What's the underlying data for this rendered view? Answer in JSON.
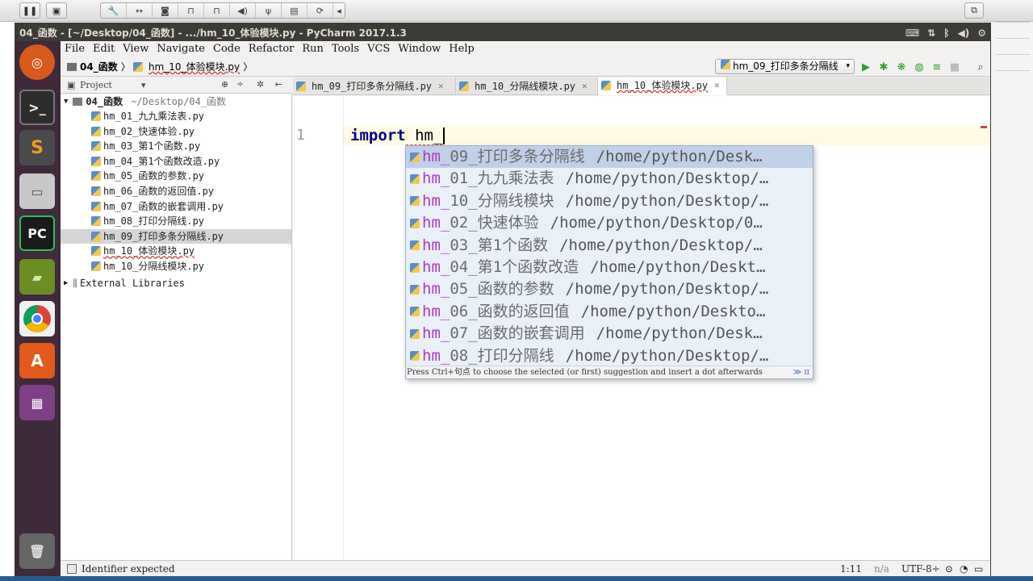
{
  "vm_toolbar": {
    "pause_icon": "pause-icon",
    "snapshot_icon": "snapshot-icon",
    "group_icons": [
      "wrench-icon",
      "arrows-icon",
      "disk-icon",
      "lock-icon",
      "lock2-icon",
      "speaker-icon",
      "usb-icon",
      "save-icon",
      "refresh-icon",
      "chevron-left-icon"
    ],
    "restore_icon": "restore-window-icon"
  },
  "window": {
    "title": "04_函数 - [~/Desktop/04_函数] - .../hm_10_体验模块.py - PyCharm 2017.1.3"
  },
  "menu": [
    "File",
    "Edit",
    "View",
    "Navigate",
    "Code",
    "Refactor",
    "Run",
    "Tools",
    "VCS",
    "Window",
    "Help"
  ],
  "breadcrumb": {
    "project": "04_函数",
    "file": "hm_10_体验模块.py"
  },
  "run_config": "hm_09_打印多条分隔线",
  "project_panel": {
    "title": "Project",
    "root_name": "04_函数",
    "root_path": "~/Desktop/04_函数",
    "files": [
      "hm_01_九九乘法表.py",
      "hm_02_快速体验.py",
      "hm_03_第1个函数.py",
      "hm_04_第1个函数改造.py",
      "hm_05_函数的参数.py",
      "hm_06_函数的返回值.py",
      "hm_07_函数的嵌套调用.py",
      "hm_08_打印分隔线.py",
      "hm_09_打印多条分隔线.py",
      "hm_10_体验模块.py",
      "hm_10_分隔线模块.py"
    ],
    "selected_index": 8,
    "external_libraries": "External Libraries"
  },
  "tabs": [
    {
      "label": "hm_09_打印多条分隔线.py",
      "active": false
    },
    {
      "label": "hm_10_分隔线模块.py",
      "active": false
    },
    {
      "label": "hm_10_体验模块.py",
      "active": true
    }
  ],
  "editor": {
    "line_number": "1",
    "keyword": "import",
    "typed": " hm_"
  },
  "completion": {
    "items": [
      {
        "prefix": "hm_",
        "rest": "09_打印多条分隔线",
        "path": "/home/python/Desk…"
      },
      {
        "prefix": "hm_",
        "rest": "01_九九乘法表",
        "path": "/home/python/Desktop/…"
      },
      {
        "prefix": "hm_",
        "rest": "10_分隔线模块",
        "path": "/home/python/Desktop/…"
      },
      {
        "prefix": "hm_",
        "rest": "02_快速体验",
        "path": "/home/python/Desktop/0…"
      },
      {
        "prefix": "hm_",
        "rest": "03_第1个函数",
        "path": "/home/python/Desktop/…"
      },
      {
        "prefix": "hm_",
        "rest": "04_第1个函数改造",
        "path": "/home/python/Deskt…"
      },
      {
        "prefix": "hm_",
        "rest": "05_函数的参数",
        "path": "/home/python/Desktop/…"
      },
      {
        "prefix": "hm_",
        "rest": "06_函数的返回值",
        "path": "/home/python/Deskto…"
      },
      {
        "prefix": "hm_",
        "rest": "07_函数的嵌套调用",
        "path": "/home/python/Desk…"
      },
      {
        "prefix": "hm_",
        "rest": "08_打印分隔线",
        "path": "/home/python/Desktop/…"
      }
    ],
    "selected_index": 0,
    "hint": "Press Ctrl+句点 to choose the selected (or first) suggestion and insert a dot afterwards",
    "hint_suffix": "≫ π"
  },
  "status": {
    "message": "Identifier expected",
    "position": "1:11",
    "na": "n/a",
    "encoding": "UTF-8÷"
  },
  "colors": {
    "accent_highlight": "#b038c4",
    "keyword": "#000080",
    "selection": "#c0d0e8",
    "launcher": "#3e2a3a"
  }
}
